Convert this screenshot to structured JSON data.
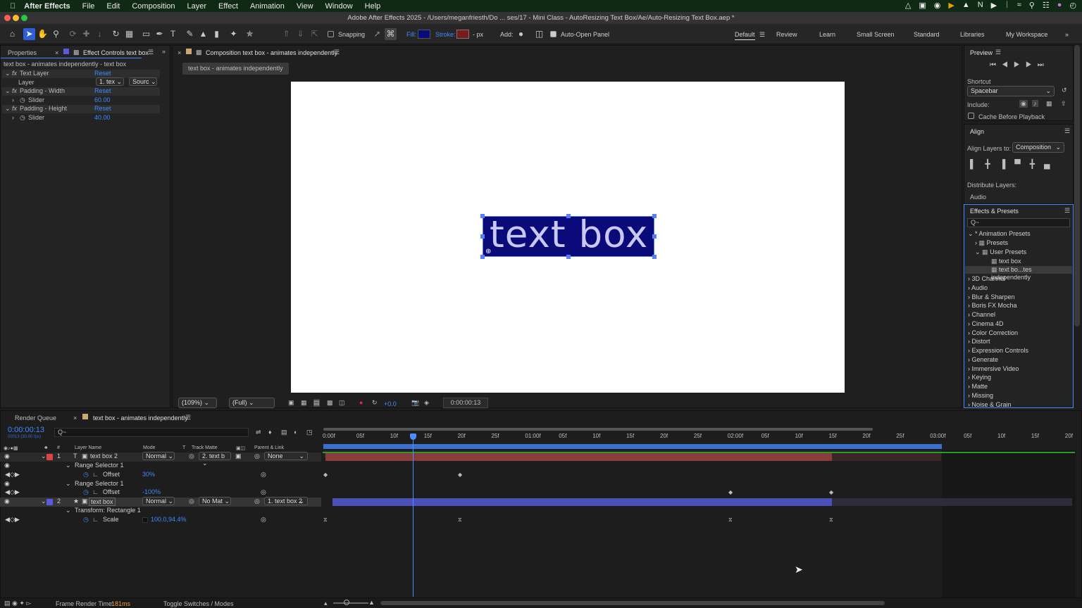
{
  "menubar": {
    "app": "After Effects",
    "items": [
      "File",
      "Edit",
      "Composition",
      "Layer",
      "Effect",
      "Animation",
      "View",
      "Window",
      "Help"
    ]
  },
  "titlebar": {
    "title": "Adobe After Effects 2025 - /Users/meganfriesth/Do ... ses/17 - Mini Class - AutoResizing Text Box/Ae/Auto-Resizing Text Box.aep *"
  },
  "toolbar": {
    "snapping": "Snapping",
    "fill": "Fill:",
    "stroke": "Stroke:",
    "px": "- px",
    "add": "Add:",
    "auto_open": "Auto-Open Panel",
    "workspaces": [
      "Default",
      "Review",
      "Learn",
      "Small Screen",
      "Standard",
      "Libraries",
      "My Workspace"
    ],
    "colors": {
      "fill": "#0a0a7a",
      "stroke": "#7a1a1a",
      "accent": "#3d8cff"
    }
  },
  "left": {
    "tab1": "Properties",
    "tab2": "Effect Controls text box",
    "header": "text box - animates independently - text box",
    "fx": [
      {
        "name": "Text Layer",
        "reset": "Reset",
        "prop": "Layer",
        "val": "1. tex",
        "val2": "Sourc"
      },
      {
        "name": "Padding - Width",
        "reset": "Reset",
        "prop": "Slider",
        "val": "60.00"
      },
      {
        "name": "Padding - Height",
        "reset": "Reset",
        "prop": "Slider",
        "val": "40.00"
      }
    ]
  },
  "comp": {
    "tab": "Composition text box - animates independently",
    "subtab": "text box - animates independently",
    "text": "text box",
    "zoom": "(109%)",
    "res": "(Full)",
    "exposure": "+0.0",
    "time": "0:00:00:13"
  },
  "preview": {
    "title": "Preview",
    "shortcut_label": "Shortcut",
    "shortcut": "Spacebar",
    "include": "Include:",
    "cache": "Cache Before Playback"
  },
  "align": {
    "title": "Align",
    "align_to_label": "Align Layers to:",
    "align_to": "Composition",
    "distribute": "Distribute Layers:",
    "audio": "Audio"
  },
  "effects": {
    "title": "Effects & Presets",
    "search_placeholder": "Q~",
    "tree": [
      "* Animation Presets",
      "Presets",
      "User Presets",
      "text box",
      "text bo...tes independently"
    ],
    "categories": [
      "3D Channel",
      "Audio",
      "Blur & Sharpen",
      "Boris FX Mocha",
      "Channel",
      "Cinema 4D",
      "Color Correction",
      "Distort",
      "Expression Controls",
      "Generate",
      "Immersive Video",
      "Keying",
      "Matte",
      "Missing",
      "Noise & Grain"
    ]
  },
  "timeline": {
    "tab1": "Render Queue",
    "tab2": "text box - animates independently",
    "timecode": "0:00:00:13",
    "fps": "00013 (30.00 fps)",
    "search": "Q~",
    "cols": [
      "Layer Name",
      "Mode",
      "T",
      "Track Matte",
      "Parent & Link"
    ],
    "ruler": [
      "0:00f",
      "05f",
      "10f",
      "15f",
      "20f",
      "25f",
      "01:00f",
      "05f",
      "10f",
      "15f",
      "20f",
      "25f",
      "02:00f",
      "05f",
      "10f",
      "15f",
      "20f",
      "25f",
      "03:00f",
      "05f",
      "10f",
      "15f",
      "20f"
    ],
    "layer1": {
      "num": "1",
      "name": "text box 2",
      "mode": "Normal",
      "matte": "2. text b",
      "parent": "None"
    },
    "rs1": "Range Selector 1",
    "offset1": {
      "name": "Offset",
      "val": "30%"
    },
    "rs2": "Range Selector 1",
    "offset2": {
      "name": "Offset",
      "val": "-100%"
    },
    "layer2": {
      "num": "2",
      "name": "text box",
      "mode": "Normal",
      "matte": "No Mat",
      "parent": "1. text box 2"
    },
    "transform": "Transform: Rectangle 1",
    "scale": {
      "name": "Scale",
      "val": "100.0,94.4%"
    },
    "frame_render_label": "Frame Render Time:",
    "frame_render": "181ms",
    "toggle": "Toggle Switches / Modes",
    "colors": {
      "layer1": "#8a3b3b",
      "layer2": "#4b4fb8",
      "playhead": "#4d8dff"
    }
  }
}
